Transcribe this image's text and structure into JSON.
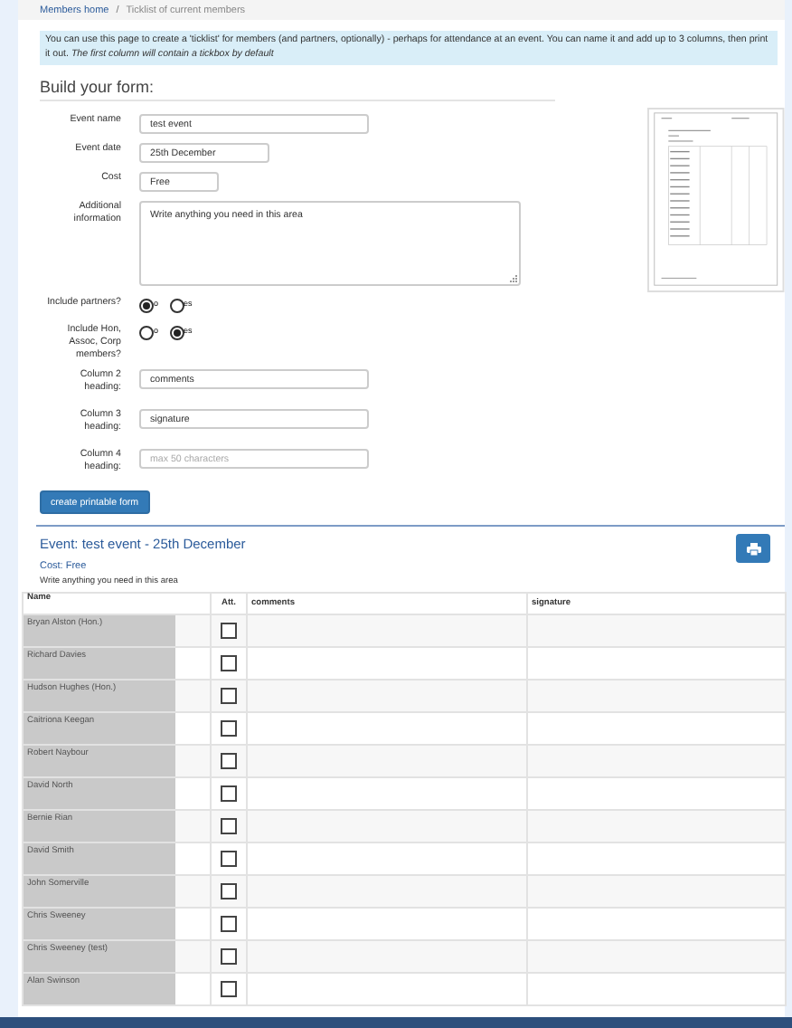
{
  "breadcrumb": [
    {
      "label": "Members home",
      "kind": "link"
    },
    {
      "label": "/",
      "kind": "separator"
    },
    {
      "label": "Ticklist of current members",
      "kind": "current"
    }
  ],
  "info": "You can use this page to create a 'ticklist' for members (and partners, optionally) - perhaps for attendance at an event. You can name it and add up to 3 columns, then print it out. *The first column will contain a tickbox by default*",
  "form": {
    "title": "Build your form:",
    "fields": [
      {
        "label": "Event name",
        "kind": "text",
        "value": "test event"
      },
      {
        "label": "Event date",
        "kind": "text",
        "value": "25th December"
      },
      {
        "label": "Cost",
        "kind": "text",
        "value": "Free"
      },
      {
        "label": "Additional information",
        "kind": "textarea",
        "value": "Write anything you need in this area"
      }
    ],
    "radios": [
      {
        "label": "Include partners?",
        "options": [
          {
            "label": "o",
            "selected": true
          },
          {
            "label": "es",
            "selected": false
          }
        ]
      },
      {
        "label": "Include Hon, Assoc, Corp members?",
        "options": [
          {
            "label": "o",
            "selected": false
          },
          {
            "label": "es",
            "selected": true
          }
        ]
      }
    ],
    "columns": [
      {
        "label": "Column 2 heading:",
        "value": "comments"
      },
      {
        "label": "Column 3 heading:",
        "value": "signature"
      },
      {
        "label": "Column 4 heading:",
        "placeholder": "max 50 characters"
      }
    ],
    "submit": "create printable form"
  },
  "event": {
    "title": "Event: test event - 25th December",
    "cost": "Cost: Free",
    "note": "Write anything you need in this area",
    "table": {
      "columns": [
        "Name",
        "Att.",
        "comments",
        "signature"
      ],
      "rows": [
        {
          "name": "Bryan Alston (Hon.)",
          "checked": false
        },
        {
          "name": "Richard Davies",
          "checked": false
        },
        {
          "name": "Hudson Hughes (Hon.)",
          "checked": false
        },
        {
          "name": "Caitriona Keegan",
          "checked": false
        },
        {
          "name": "Robert Naybour",
          "checked": false
        },
        {
          "name": "David North",
          "checked": false
        },
        {
          "name": "Bernie Rian",
          "checked": false
        },
        {
          "name": "David Smith",
          "checked": false
        },
        {
          "name": "John Somerville",
          "checked": false
        },
        {
          "name": "Chris Sweeney",
          "checked": false
        },
        {
          "name": "Chris Sweeney (test)",
          "checked": false
        },
        {
          "name": "Alan Swinson",
          "checked": false
        }
      ]
    }
  }
}
